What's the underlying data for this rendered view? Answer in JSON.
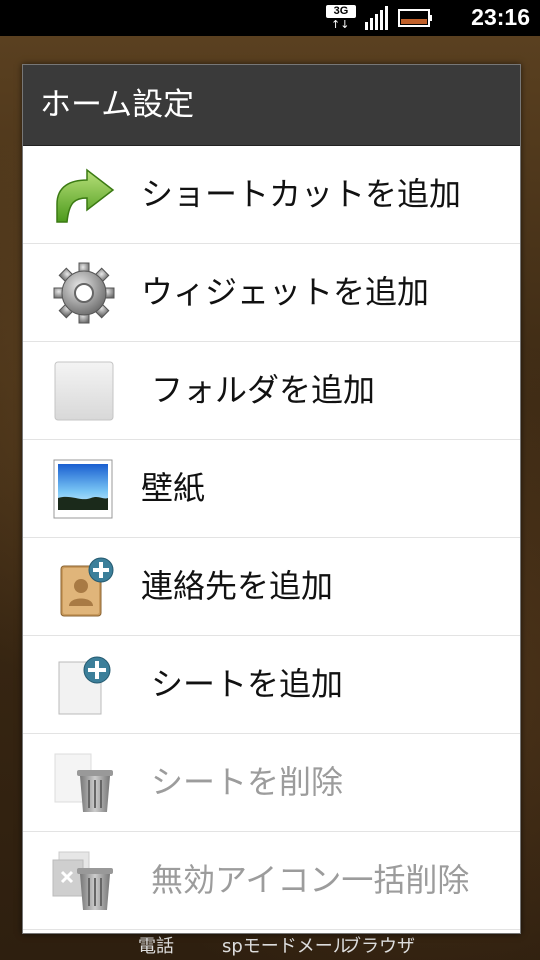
{
  "status_bar": {
    "network": "3G",
    "time": "23:16"
  },
  "dialog": {
    "title": "ホーム設定",
    "items": [
      {
        "label": "ショートカットを追加",
        "icon": "shortcut-arrow-icon",
        "enabled": true
      },
      {
        "label": "ウィジェットを追加",
        "icon": "gear-icon",
        "enabled": true
      },
      {
        "label": "フォルダを追加",
        "icon": "folder-icon",
        "enabled": true
      },
      {
        "label": "壁紙",
        "icon": "wallpaper-image-icon",
        "enabled": true
      },
      {
        "label": "連絡先を追加",
        "icon": "add-contact-icon",
        "enabled": true
      },
      {
        "label": "シートを追加",
        "icon": "add-sheet-icon",
        "enabled": true
      },
      {
        "label": "シートを削除",
        "icon": "delete-sheet-icon",
        "enabled": false
      },
      {
        "label": "無効アイコン一括削除",
        "icon": "bulk-delete-icon",
        "enabled": false
      }
    ]
  },
  "dock": {
    "phone": "電話",
    "mail": "spモードメール",
    "browser": "ブラウザ"
  },
  "colors": {
    "title_bar": "#3a3a3a",
    "disabled_text": "#9c9c9c"
  }
}
